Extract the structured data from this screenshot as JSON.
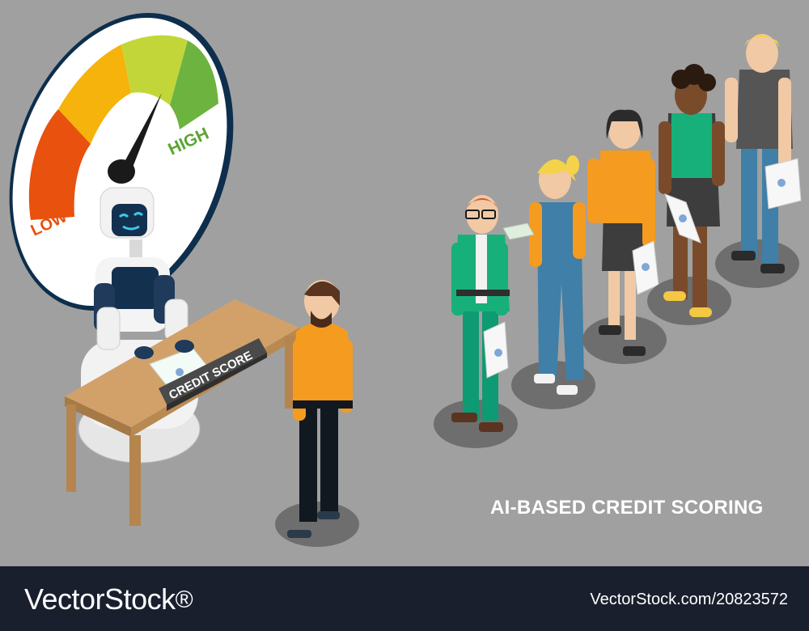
{
  "gauge": {
    "low_label": "LOW",
    "high_label": "HIGH",
    "colors": {
      "low": "#e8510e",
      "mid_low": "#f3a512",
      "mid": "#f5c10c",
      "mid_high": "#bcd63a",
      "high": "#6db33f"
    }
  },
  "desk": {
    "sign_label": "CREDIT SCORE"
  },
  "caption": "AI-BASED CREDIT SCORING",
  "footer": {
    "brand": "VectorStock",
    "brand_mark": "®",
    "image_id": "VectorStock.com/20823572"
  }
}
